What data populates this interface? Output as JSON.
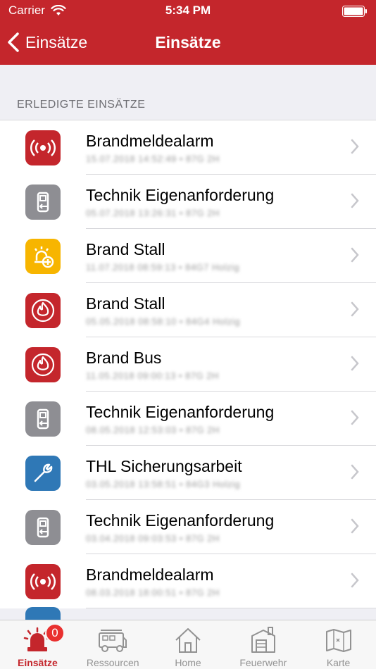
{
  "status_bar": {
    "carrier": "Carrier",
    "time": "5:34 PM"
  },
  "nav": {
    "back_label": "Einsätze",
    "title": "Einsätze"
  },
  "section": {
    "header": "ERLEDIGTE EINSÄTZE"
  },
  "rows": [
    {
      "title": "Brandmeldealarm",
      "subtitle": "15.07.2018 14:52:49 • 87G 2H",
      "icon": "alarm-signal-icon",
      "color": "#c4262c"
    },
    {
      "title": "Technik Eigenanforderung",
      "subtitle": "05.07.2018 13:26:31 • 87G 2H",
      "icon": "radio-device-icon",
      "color": "#8e8e93"
    },
    {
      "title": "Brand Stall",
      "subtitle": "11.07.2018 08:59:13 • 84G7 Holzig",
      "icon": "fire-alarm-plus-icon",
      "color": "#f7b500"
    },
    {
      "title": "Brand Stall",
      "subtitle": "05.05.2018 08:58:10 • 84G4 Holzig",
      "icon": "flame-icon",
      "color": "#c4262c"
    },
    {
      "title": "Brand Bus",
      "subtitle": "11.05.2018 09:00:13 • 87G 2H",
      "icon": "flame-icon",
      "color": "#c4262c"
    },
    {
      "title": "Technik Eigenanforderung",
      "subtitle": "08.05.2018 12:53:03 • 87G 2H",
      "icon": "radio-device-icon",
      "color": "#8e8e93"
    },
    {
      "title": "THL Sicherungsarbeit",
      "subtitle": "03.05.2018 13:58:51 • 84G3 Holzig",
      "icon": "wrench-icon",
      "color": "#2f78b6"
    },
    {
      "title": "Technik Eigenanforderung",
      "subtitle": "03.04.2018 09:03:53 • 87G 2H",
      "icon": "radio-device-icon",
      "color": "#8e8e93"
    },
    {
      "title": "Brandmeldealarm",
      "subtitle": "08.03.2018 18:00:51 • 87G 2H",
      "icon": "alarm-signal-icon",
      "color": "#c4262c"
    }
  ],
  "tabbar": {
    "badge_count": "0",
    "tabs": [
      {
        "label": "Einsätze",
        "icon": "siren-icon",
        "active": true
      },
      {
        "label": "Ressourcen",
        "icon": "fire-truck-icon",
        "active": false
      },
      {
        "label": "Home",
        "icon": "home-icon",
        "active": false
      },
      {
        "label": "Feuerwehr",
        "icon": "fire-station-icon",
        "active": false
      },
      {
        "label": "Karte",
        "icon": "map-icon",
        "active": false
      }
    ]
  },
  "colors": {
    "brand_red": "#c4262c",
    "badge_red": "#e9302f",
    "grey": "#8e8e93",
    "yellow": "#f7b500",
    "blue": "#2f78b6"
  }
}
